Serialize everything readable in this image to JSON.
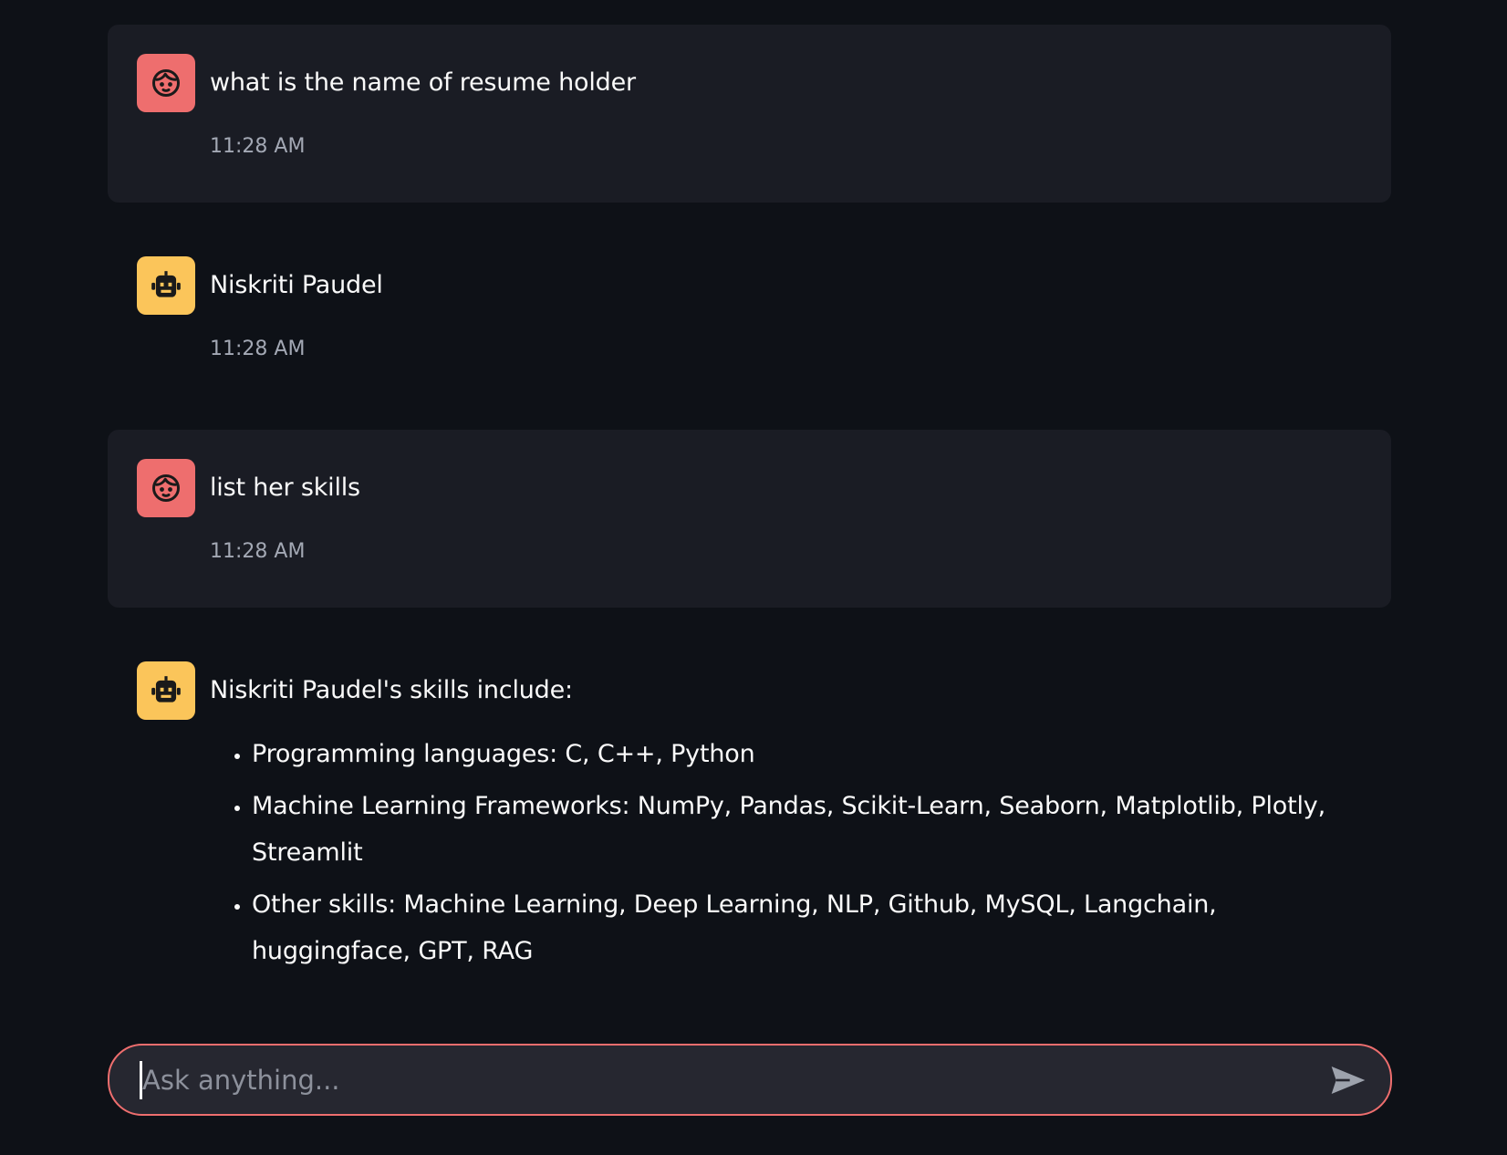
{
  "messages": [
    {
      "role": "user",
      "avatar_icon": "user-face-icon",
      "text": "what is the name of resume holder",
      "time": "11:28 AM"
    },
    {
      "role": "assistant",
      "avatar_icon": "robot-icon",
      "text": "Niskriti Paudel",
      "time": "11:28 AM"
    },
    {
      "role": "user",
      "avatar_icon": "user-face-icon",
      "text": "list her skills",
      "time": "11:28 AM"
    },
    {
      "role": "assistant",
      "avatar_icon": "robot-icon",
      "text": "Niskriti Paudel's skills include:",
      "list": [
        "Programming languages: C, C++, Python",
        "Machine Learning Frameworks: NumPy, Pandas, Scikit-Learn, Seaborn, Matplotlib, Plotly, Streamlit",
        "Other skills: Machine Learning, Deep Learning, NLP, Github, MySQL, Langchain, huggingface, GPT, RAG"
      ]
    }
  ],
  "chat_input": {
    "placeholder": "Ask anything...",
    "value": "",
    "send_icon": "send-icon"
  },
  "colors": {
    "background": "#0e1117",
    "user_bubble": "#1a1c24",
    "user_avatar": "#ee6e6e",
    "bot_avatar": "#fbc55a",
    "input_border": "#ee6e6e"
  }
}
